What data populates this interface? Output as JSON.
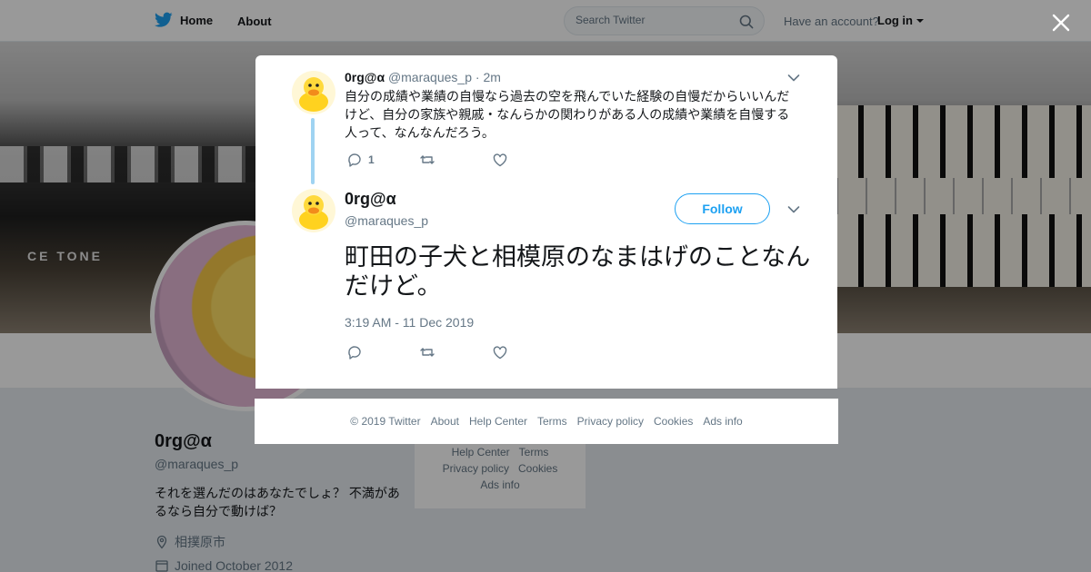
{
  "topbar": {
    "home_label": "Home",
    "about_label": "About",
    "search_placeholder": "Search Twitter",
    "have_account": "Have an account?",
    "login_label": "Log in"
  },
  "banner": {
    "label": "CE TONE"
  },
  "profile": {
    "name": "0rg@α",
    "handle": "@maraques_p",
    "bio": "それを選んだのはあなたでしょ？ 不満があるなら自分で動けば？",
    "location": "相撲原市",
    "joined": "Joined October 2012"
  },
  "side_footer": {
    "row1": [
      "Help Center",
      "Terms"
    ],
    "row2": [
      "Privacy policy",
      "Cookies"
    ],
    "row3": [
      "Ads info"
    ]
  },
  "tweet1": {
    "name": "0rg@α",
    "handle": "@maraques_p",
    "separator": "·",
    "time": "2m",
    "text": "自分の成績や業績の自慢なら過去の空を飛んでいた経験の自慢だからいいんだけど、自分の家族や親戚・なんらかの関わりがある人の成績や業績を自慢する人って、なんなんだろう。",
    "reply_count": "1"
  },
  "tweet2": {
    "name": "0rg@α",
    "handle": "@maraques_p",
    "follow_label": "Follow",
    "text": "町田の子犬と相模原のなまはげのことなんだけど。",
    "timestamp": "3:19 AM - 11 Dec 2019"
  },
  "modal_footer": {
    "copyright": "© 2019 Twitter",
    "links": [
      "About",
      "Help Center",
      "Terms",
      "Privacy policy",
      "Cookies",
      "Ads info"
    ]
  },
  "colors": {
    "twitter_blue": "#1da1f2",
    "thread_line": "#9fd3f2",
    "muted_text": "#657786"
  },
  "icons": [
    "twitter-bird-icon",
    "search-icon",
    "close-icon",
    "chevron-down-icon",
    "reply-icon",
    "retweet-icon",
    "like-icon",
    "location-icon",
    "calendar-icon"
  ]
}
